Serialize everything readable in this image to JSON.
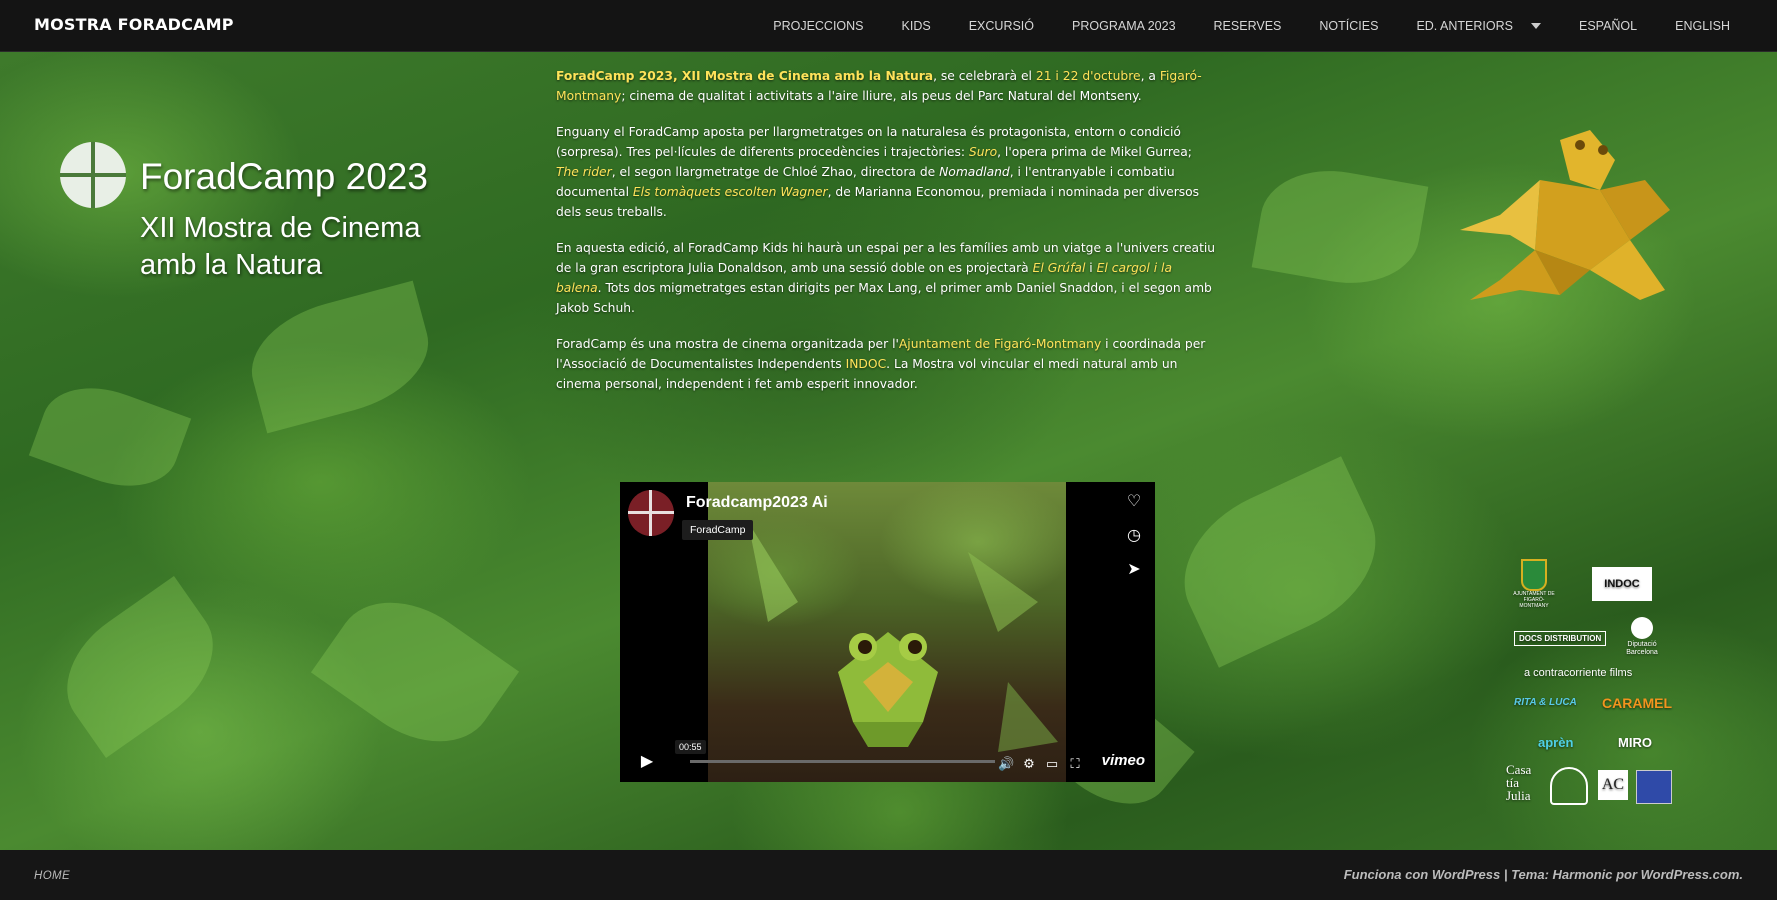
{
  "site": {
    "title": "MOSTRA FORADCAMP"
  },
  "nav": {
    "items": [
      "PROJECCIONS",
      "KIDS",
      "EXCURSIÓ",
      "PROGRAMA 2023",
      "RESERVES",
      "NOTÍCIES",
      "ED. ANTERIORS",
      "ESPAÑOL",
      "ENGLISH"
    ]
  },
  "hero": {
    "title": "ForadCamp 2023",
    "subtitle": "XII Mostra de Cinema amb la Natura"
  },
  "intro": {
    "p1": {
      "a": "ForadCamp 2023, XII Mostra de Cinema amb la Natura",
      "b": ", se celebrarà el ",
      "c": "21 i 22 d'octubre",
      "d": ", a ",
      "e": "Figaró-Montmany",
      "f": "; cinema de qualitat i activitats a l'aire lliure, als peus del Parc Natural del Montseny."
    },
    "p2": {
      "a": "Enguany el ForadCamp aposta per llargmetratges on la naturalesa és protagonista, entorn o condició (sorpresa). Tres pel·lícules de diferents procedències i trajectòries: ",
      "b": "Suro",
      "c": ", l'opera prima de Mikel Gurrea; ",
      "d": "The rider",
      "e": ", el segon llargmetratge de Chloé Zhao, directora de ",
      "f": "Nomadland",
      "g": ", i l'entranyable i combatiu documental ",
      "h": "Els tomàquets escolten Wagner",
      "i": ", de Marianna Economou, premiada i nominada per diversos dels seus treballs."
    },
    "p3": {
      "a": "En aquesta edició, al ForadCamp Kids hi haurà un espai per a les famílies amb un viatge a l'univers creatiu de la gran escriptora Julia Donaldson, amb una sessió doble on es projectarà ",
      "b": "El Grúfal",
      "c": " i ",
      "d": "El cargol i la balena",
      "e": ". Tots dos migmetratges estan dirigits per Max Lang, el primer amb Daniel Snaddon, i el segon amb Jakob Schuh."
    },
    "p4": {
      "a": "ForadCamp és una mostra de cinema organitzada per l'",
      "b": "Ajuntament de Figaró-Montmany",
      "c": " i coordinada per l'Associació de Documentalistes Independents ",
      "d": "INDOC",
      "e": ". La Mostra vol vincular el medi natural amb un cinema personal, independent i fet amb esperit innovador."
    }
  },
  "video": {
    "title": "Foradcamp2023 Ai",
    "owner": "ForadCamp",
    "time": "00:55",
    "brand": "vimeo",
    "progress": 0.0
  },
  "sponsors": {
    "ajuntament": "AJUNTAMENT DE FIGARÓ-MONTMANY",
    "indoc": "INDOC",
    "docs": "DOCS DISTRIBUTION",
    "diputacio": "Diputació Barcelona",
    "contracorriente": "a contracorriente films",
    "rita": "RITA & LUCA",
    "caramel": "CARAMEL",
    "apren": "aprèn",
    "miro": "MIRO",
    "casa1": "Casa",
    "casa2": "tía",
    "casa3": "Julia",
    "ac": "AC"
  },
  "footer": {
    "home": "HOME",
    "credit": "Funciona con WordPress | Tema: Harmonic por WordPress.com."
  },
  "colors": {
    "highlight": "#ffe35a",
    "topbar": "#141414",
    "footer": "#161616"
  }
}
